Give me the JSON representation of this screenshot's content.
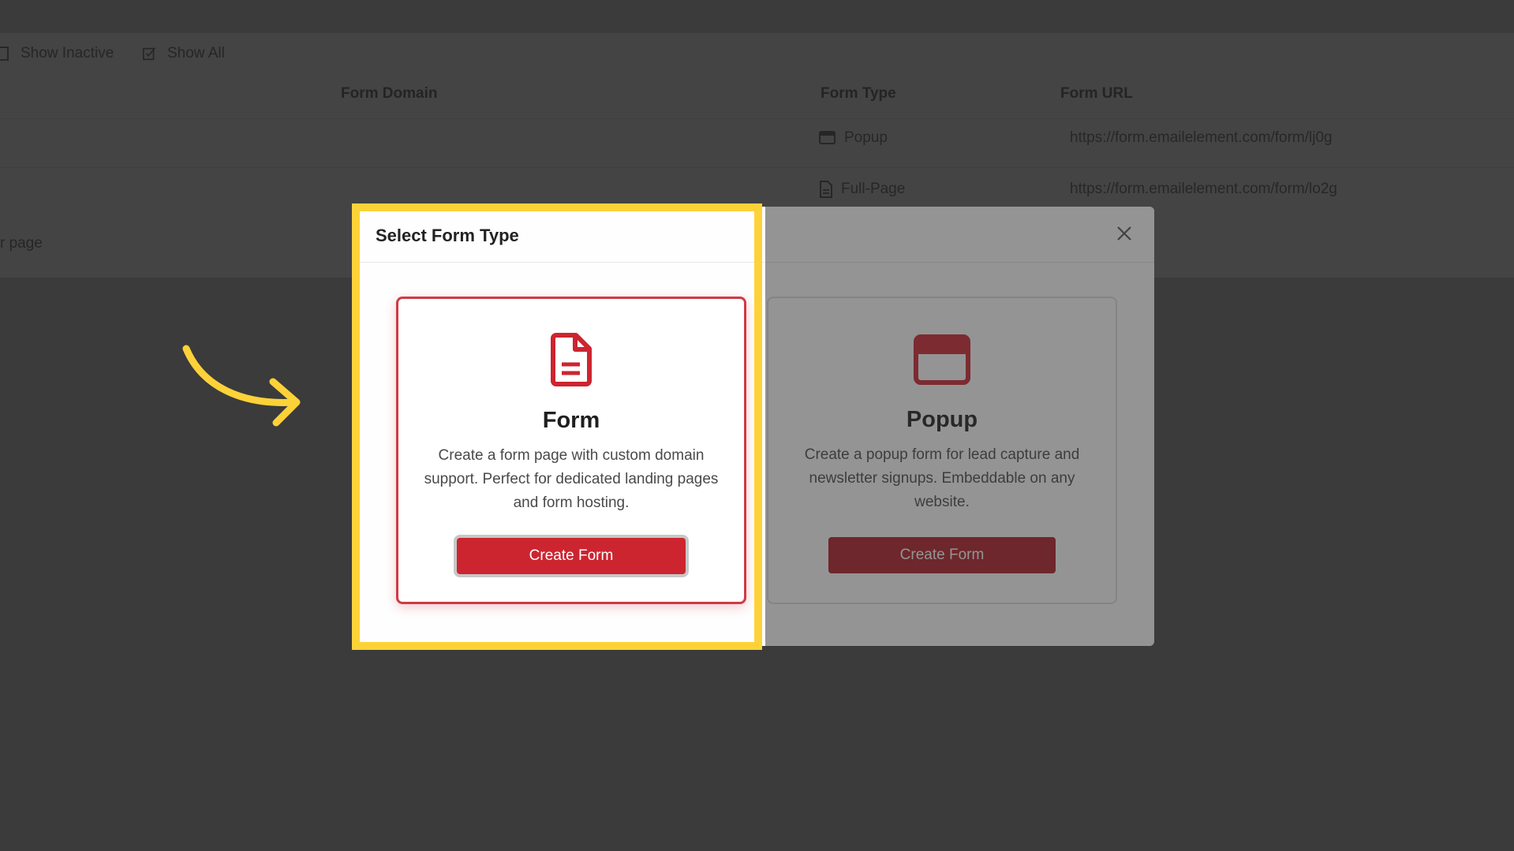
{
  "toolbar": {
    "show_inactive": "Show Inactive",
    "show_all": "Show All"
  },
  "table": {
    "headers": {
      "domain": "Form Domain",
      "type": "Form Type",
      "url": "Form URL"
    },
    "rows": [
      {
        "type": "Popup",
        "type_icon": "window-icon",
        "url": "https://form.emailelement.com/form/lj0g"
      },
      {
        "type": "Full-Page",
        "type_icon": "document-icon",
        "url": "https://form.emailelement.com/form/lo2g"
      }
    ],
    "pager_text": "r page"
  },
  "modal": {
    "title": "Select Form Type",
    "close_icon": "close-icon",
    "options": [
      {
        "title": "Form",
        "icon": "document-icon",
        "description": "Create a form page with custom domain support. Perfect for dedicated landing pages and form hosting.",
        "button": "Create Form",
        "selected": true
      },
      {
        "title": "Popup",
        "icon": "browser-window-icon",
        "description": "Create a popup form for lead capture and newsletter signups. Embeddable on any website.",
        "button": "Create Form",
        "selected": false
      }
    ]
  },
  "colors": {
    "brand_red": "#cc2530",
    "highlight_yellow": "#fdd239",
    "overlay": "#3b3b3b"
  }
}
